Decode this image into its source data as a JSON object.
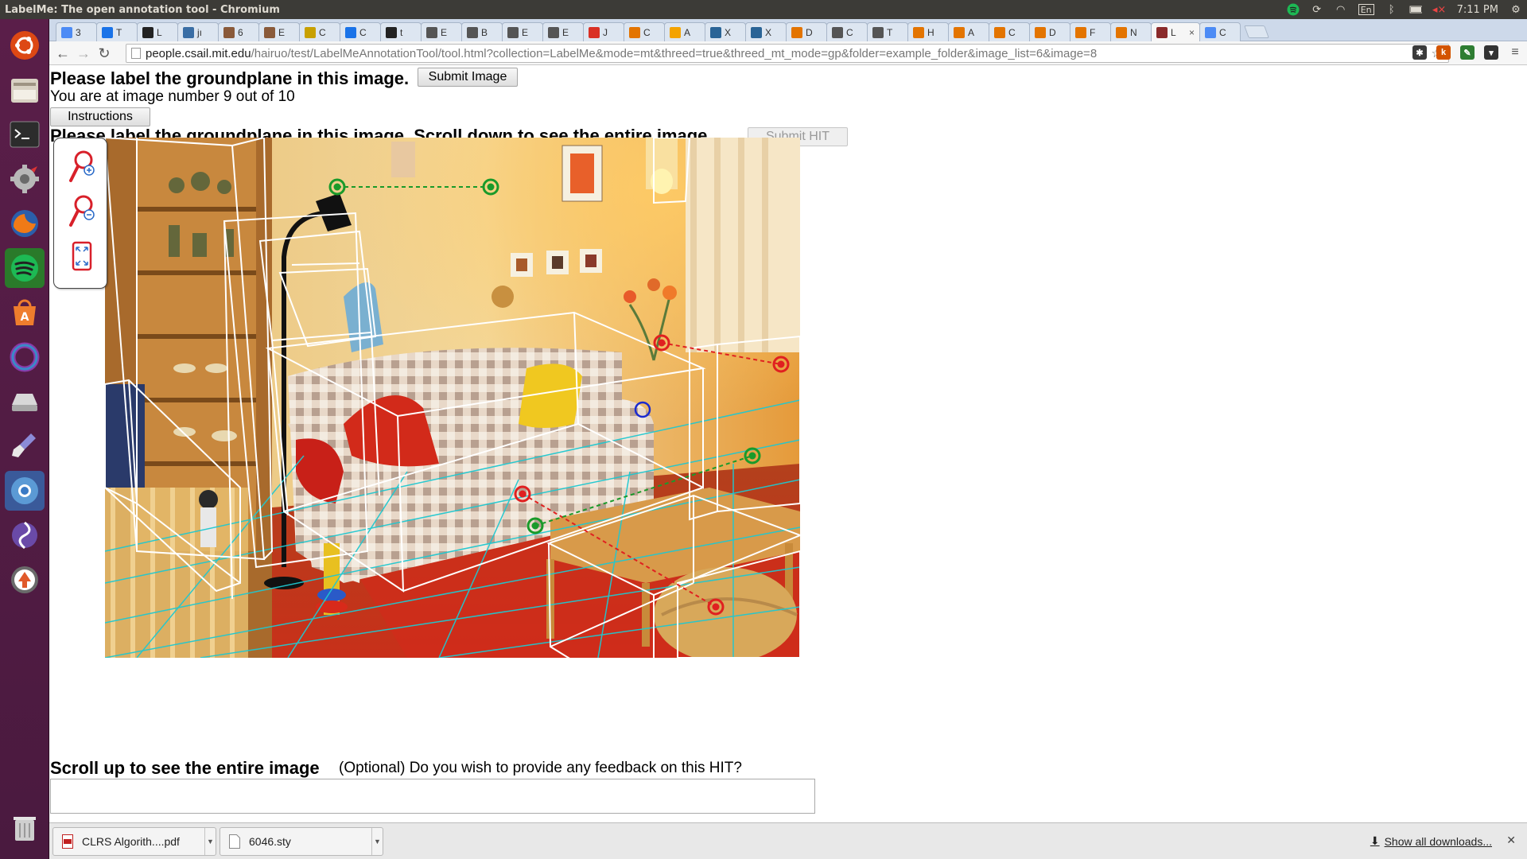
{
  "system": {
    "window_title": "LabelMe: The open annotation tool - Chromium",
    "keyboard_layout": "En",
    "clock": "7:11 PM"
  },
  "browser": {
    "tabs": [
      {
        "label": "3",
        "icon_color": "#4c8bf5"
      },
      {
        "label": "T",
        "icon_color": "#1a73e8"
      },
      {
        "label": "L",
        "icon_color": "#222222"
      },
      {
        "label": "jı",
        "icon_color": "#3a6ea5"
      },
      {
        "label": "6",
        "icon_color": "#8a5a3a"
      },
      {
        "label": "E",
        "icon_color": "#8a5a3a"
      },
      {
        "label": "C",
        "icon_color": "#c8a000"
      },
      {
        "label": "C",
        "icon_color": "#1a73e8"
      },
      {
        "label": "t",
        "icon_color": "#222222"
      },
      {
        "label": "E",
        "icon_color": "#555555"
      },
      {
        "label": "B",
        "icon_color": "#555555"
      },
      {
        "label": "E",
        "icon_color": "#555555"
      },
      {
        "label": "E",
        "icon_color": "#555555"
      },
      {
        "label": "J",
        "icon_color": "#d93025"
      },
      {
        "label": "C",
        "icon_color": "#e37400"
      },
      {
        "label": "A",
        "icon_color": "#f4a300"
      },
      {
        "label": "X",
        "icon_color": "#2a6496"
      },
      {
        "label": "X",
        "icon_color": "#2a6496"
      },
      {
        "label": "D",
        "icon_color": "#e37400"
      },
      {
        "label": "C",
        "icon_color": "#555555"
      },
      {
        "label": "T",
        "icon_color": "#555555"
      },
      {
        "label": "H",
        "icon_color": "#e37400"
      },
      {
        "label": "A",
        "icon_color": "#e37400"
      },
      {
        "label": "C",
        "icon_color": "#e37400"
      },
      {
        "label": "D",
        "icon_color": "#e37400"
      },
      {
        "label": "F",
        "icon_color": "#e37400"
      },
      {
        "label": "N",
        "icon_color": "#e37400"
      },
      {
        "label": "L",
        "icon_color": "#8a2a2a"
      },
      {
        "label": "C",
        "icon_color": "#4c8bf5"
      }
    ],
    "active_tab_index": 27,
    "url_host": "people.csail.mit.edu",
    "url_path": "/hairuo/test/LabelMeAnnotationTool/tool.html?collection=LabelMe&mode=mt&threed=true&threed_mt_mode=gp&folder=example_folder&image_list=6&image=8"
  },
  "page": {
    "header_title": "Please label the groundplane in this image.",
    "submit_image_label": "Submit Image",
    "progress_text": "You are at image number 9 out of 10",
    "instructions_label": "Instructions",
    "cut_title": "Please label the groundplane in this image. Scroll down to see the entire image",
    "submit_hit_label": "Submit HIT",
    "scroll_up_label": "Scroll up to see the entire image",
    "feedback_question": "(Optional) Do you wish to provide any feedback on this HIT?",
    "feedback_value": ""
  },
  "tools": [
    {
      "name": "zoom-in-icon"
    },
    {
      "name": "zoom-out-icon"
    },
    {
      "name": "fit-to-screen-icon"
    }
  ],
  "downloads": {
    "items": [
      {
        "filename": "CLRS Algorith....pdf",
        "type": "pdf"
      },
      {
        "filename": "6046.sty",
        "type": "file"
      }
    ],
    "show_all_label": "Show all downloads..."
  },
  "colors": {
    "annotation_box": "#ffffff",
    "ground_grid": "#1fc8d0",
    "point_green": "#1a9a2a",
    "point_red": "#e02020",
    "point_blue": "#1a2ad0",
    "launcher": "#4d1a41"
  }
}
